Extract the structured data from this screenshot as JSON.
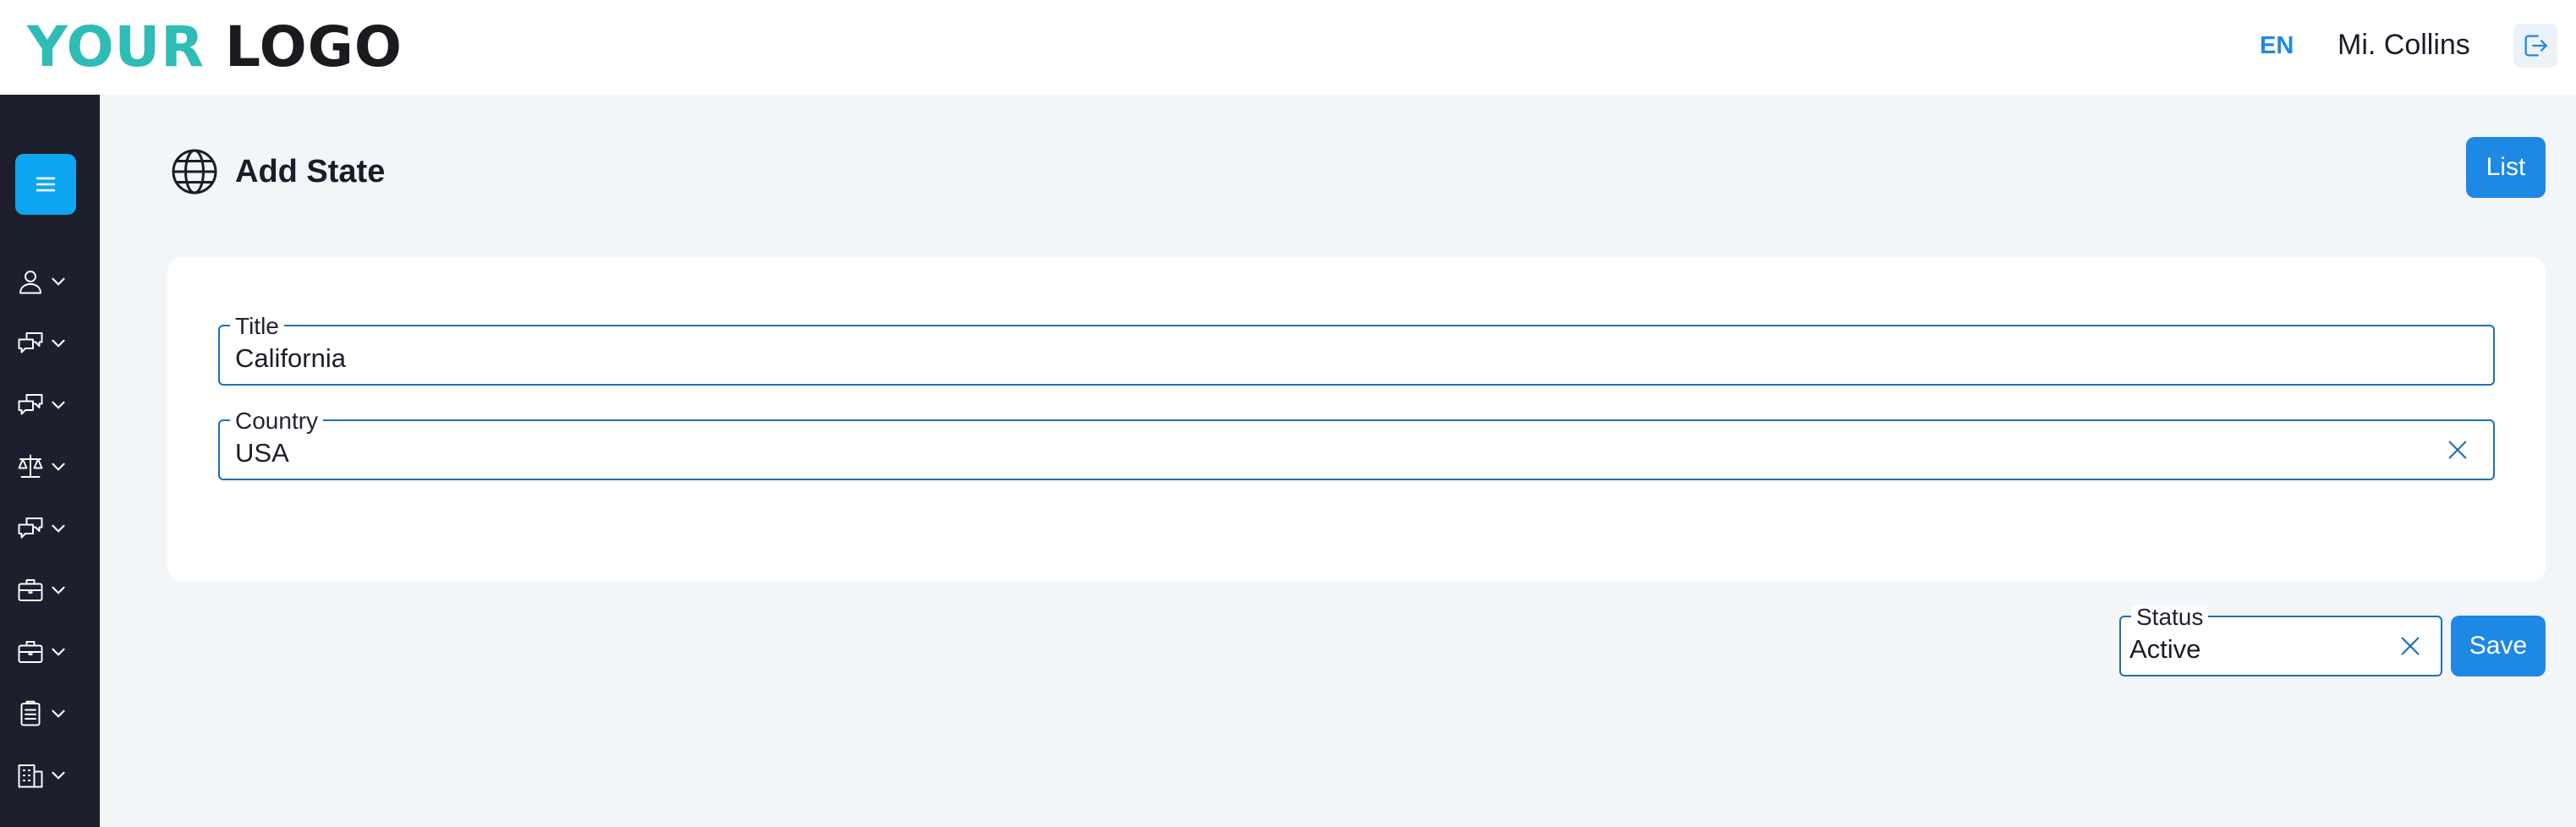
{
  "header": {
    "logo_part1": "YOUR",
    "logo_part2": "LOGO",
    "language": "EN",
    "user_name": "Mi. Collins"
  },
  "sidebar": {
    "items": [
      {
        "icon": "user-icon"
      },
      {
        "icon": "chat-bubbles-icon"
      },
      {
        "icon": "chat-bubbles-icon"
      },
      {
        "icon": "scale-icon"
      },
      {
        "icon": "chat-bubbles-icon"
      },
      {
        "icon": "briefcase-icon"
      },
      {
        "icon": "briefcase-icon"
      },
      {
        "icon": "clipboard-icon"
      },
      {
        "icon": "building-icon"
      }
    ]
  },
  "page": {
    "title": "Add State",
    "list_button": "List"
  },
  "form": {
    "title": {
      "label": "Title",
      "value": "California"
    },
    "country": {
      "label": "Country",
      "value": "USA"
    },
    "status": {
      "label": "Status",
      "value": "Active"
    },
    "save_button": "Save"
  },
  "colors": {
    "accent": "#1e88e5",
    "sidebar_bg": "#1d1f2e",
    "menu_button": "#0ea5f0",
    "logo_teal": "#2fbcb6"
  }
}
